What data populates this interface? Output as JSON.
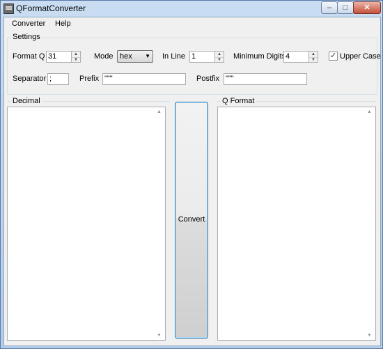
{
  "window": {
    "title": "QFormatConverter",
    "min": "–",
    "max": "□",
    "close": "✕"
  },
  "menu": [
    "Converter",
    "Help"
  ],
  "settings": {
    "legend": "Settings",
    "format_q": {
      "label": "Format Q",
      "value": "31"
    },
    "mode": {
      "label": "Mode",
      "value": "hex"
    },
    "in_line": {
      "label": "In Line",
      "value": "1"
    },
    "min_digits": {
      "label": "Minimum Digits",
      "value": "4"
    },
    "upper_case": {
      "label": "Upper Case",
      "checked": true
    },
    "separator": {
      "label": "Separator",
      "value": ";"
    },
    "prefix": {
      "label": "Prefix",
      "value": "\"\"\""
    },
    "postfix": {
      "label": "Postfix",
      "value": "\"\"\""
    }
  },
  "decimal": {
    "label": "Decimal",
    "value": ""
  },
  "qformat": {
    "label": "Q Format",
    "value": ""
  },
  "convert": {
    "label": "Convert"
  }
}
